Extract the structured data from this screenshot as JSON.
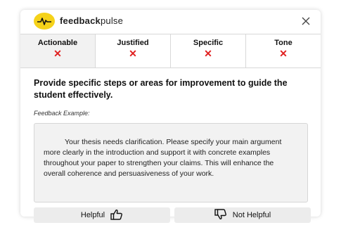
{
  "brand": {
    "name_part1": "feedback",
    "name_part2": "pulse",
    "logo_icon": "pulse-wave-icon",
    "logo_color": "#f5d21a"
  },
  "header": {
    "close_icon": "close-icon"
  },
  "tabs": [
    {
      "label": "Actionable",
      "status": "✕",
      "active": true
    },
    {
      "label": "Justified",
      "status": "✕",
      "active": false
    },
    {
      "label": "Specific",
      "status": "✕",
      "active": false
    },
    {
      "label": "Tone",
      "status": "✕",
      "active": false
    }
  ],
  "status_color": "#e02020",
  "main": {
    "heading": "Provide specific steps or areas for improvement to guide the student effectively.",
    "example_label": "Feedback Example:",
    "example_text": "Your thesis needs clarification. Please specify your main argument more clearly in the introduction and support it with concrete examples throughout your paper to strengthen your claims. This will enhance the overall coherence and persuasiveness of your work."
  },
  "actions": {
    "helpful_label": "Helpful",
    "helpful_icon": "thumbs-up-icon",
    "not_helpful_label": "Not Helpful",
    "not_helpful_icon": "thumbs-down-icon"
  }
}
